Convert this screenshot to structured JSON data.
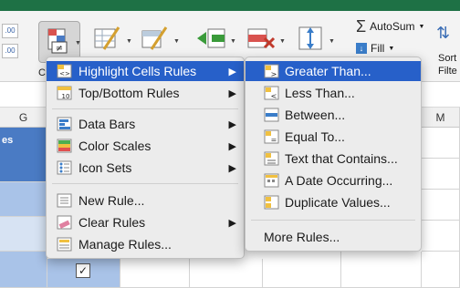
{
  "ribbon": {
    "left_mini_values": [
      ".00",
      ".00"
    ],
    "cond_format_label": "Co",
    "autosum_label": "AutoSum",
    "fill_label": "Fill",
    "sort_label_1": "Sort",
    "sort_label_2": "Filte"
  },
  "columns": [
    "G",
    "M"
  ],
  "header_cell_text": "es",
  "main_menu": {
    "items": [
      {
        "label": "Highlight Cells Rules",
        "icon": "highlight-cells-icon",
        "submenu": true
      },
      {
        "label": "Top/Bottom Rules",
        "icon": "top-bottom-icon",
        "submenu": true
      },
      {
        "label": "Data Bars",
        "icon": "data-bars-icon",
        "submenu": true
      },
      {
        "label": "Color Scales",
        "icon": "color-scales-icon",
        "submenu": true
      },
      {
        "label": "Icon Sets",
        "icon": "icon-sets-icon",
        "submenu": true
      },
      {
        "label": "New Rule...",
        "icon": "new-rule-icon",
        "submenu": false
      },
      {
        "label": "Clear Rules",
        "icon": "clear-rules-icon",
        "submenu": true
      },
      {
        "label": "Manage Rules...",
        "icon": "manage-rules-icon",
        "submenu": false
      }
    ],
    "arrow": "▶"
  },
  "sub_menu": {
    "items": [
      {
        "label": "Greater Than...",
        "icon": "greater-than-icon"
      },
      {
        "label": "Less Than...",
        "icon": "less-than-icon"
      },
      {
        "label": "Between...",
        "icon": "between-icon"
      },
      {
        "label": "Equal To...",
        "icon": "equal-to-icon"
      },
      {
        "label": "Text that Contains...",
        "icon": "text-contains-icon"
      },
      {
        "label": "A Date Occurring...",
        "icon": "date-occurring-icon"
      },
      {
        "label": "Duplicate Values...",
        "icon": "duplicate-values-icon"
      },
      {
        "label": "More Rules...",
        "icon": ""
      }
    ]
  },
  "checkbox_mark": "✓",
  "colors": {
    "highlight": "#2760c9",
    "excel_green": "#1e7145",
    "table_blue": "#a9c3e8"
  }
}
